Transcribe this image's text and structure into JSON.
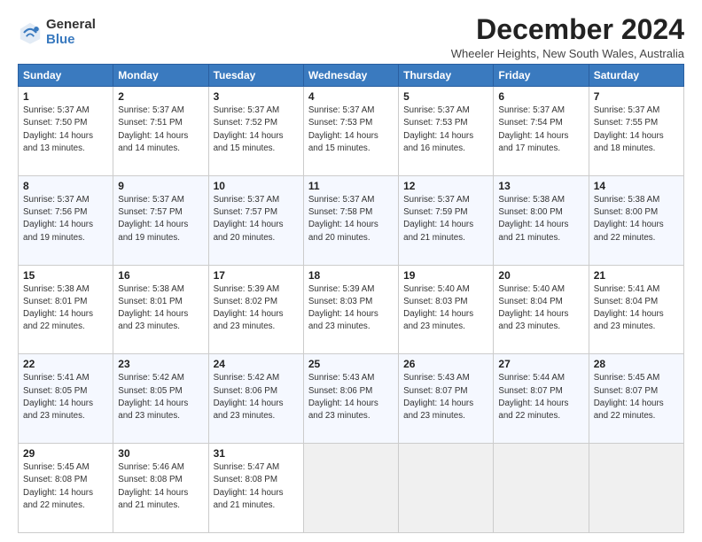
{
  "logo": {
    "general": "General",
    "blue": "Blue"
  },
  "title": "December 2024",
  "location": "Wheeler Heights, New South Wales, Australia",
  "days_of_week": [
    "Sunday",
    "Monday",
    "Tuesday",
    "Wednesday",
    "Thursday",
    "Friday",
    "Saturday"
  ],
  "weeks": [
    [
      {
        "day": "1",
        "info": "Sunrise: 5:37 AM\nSunset: 7:50 PM\nDaylight: 14 hours\nand 13 minutes."
      },
      {
        "day": "2",
        "info": "Sunrise: 5:37 AM\nSunset: 7:51 PM\nDaylight: 14 hours\nand 14 minutes."
      },
      {
        "day": "3",
        "info": "Sunrise: 5:37 AM\nSunset: 7:52 PM\nDaylight: 14 hours\nand 15 minutes."
      },
      {
        "day": "4",
        "info": "Sunrise: 5:37 AM\nSunset: 7:53 PM\nDaylight: 14 hours\nand 15 minutes."
      },
      {
        "day": "5",
        "info": "Sunrise: 5:37 AM\nSunset: 7:53 PM\nDaylight: 14 hours\nand 16 minutes."
      },
      {
        "day": "6",
        "info": "Sunrise: 5:37 AM\nSunset: 7:54 PM\nDaylight: 14 hours\nand 17 minutes."
      },
      {
        "day": "7",
        "info": "Sunrise: 5:37 AM\nSunset: 7:55 PM\nDaylight: 14 hours\nand 18 minutes."
      }
    ],
    [
      {
        "day": "8",
        "info": "Sunrise: 5:37 AM\nSunset: 7:56 PM\nDaylight: 14 hours\nand 19 minutes."
      },
      {
        "day": "9",
        "info": "Sunrise: 5:37 AM\nSunset: 7:57 PM\nDaylight: 14 hours\nand 19 minutes."
      },
      {
        "day": "10",
        "info": "Sunrise: 5:37 AM\nSunset: 7:57 PM\nDaylight: 14 hours\nand 20 minutes."
      },
      {
        "day": "11",
        "info": "Sunrise: 5:37 AM\nSunset: 7:58 PM\nDaylight: 14 hours\nand 20 minutes."
      },
      {
        "day": "12",
        "info": "Sunrise: 5:37 AM\nSunset: 7:59 PM\nDaylight: 14 hours\nand 21 minutes."
      },
      {
        "day": "13",
        "info": "Sunrise: 5:38 AM\nSunset: 8:00 PM\nDaylight: 14 hours\nand 21 minutes."
      },
      {
        "day": "14",
        "info": "Sunrise: 5:38 AM\nSunset: 8:00 PM\nDaylight: 14 hours\nand 22 minutes."
      }
    ],
    [
      {
        "day": "15",
        "info": "Sunrise: 5:38 AM\nSunset: 8:01 PM\nDaylight: 14 hours\nand 22 minutes."
      },
      {
        "day": "16",
        "info": "Sunrise: 5:38 AM\nSunset: 8:01 PM\nDaylight: 14 hours\nand 23 minutes."
      },
      {
        "day": "17",
        "info": "Sunrise: 5:39 AM\nSunset: 8:02 PM\nDaylight: 14 hours\nand 23 minutes."
      },
      {
        "day": "18",
        "info": "Sunrise: 5:39 AM\nSunset: 8:03 PM\nDaylight: 14 hours\nand 23 minutes."
      },
      {
        "day": "19",
        "info": "Sunrise: 5:40 AM\nSunset: 8:03 PM\nDaylight: 14 hours\nand 23 minutes."
      },
      {
        "day": "20",
        "info": "Sunrise: 5:40 AM\nSunset: 8:04 PM\nDaylight: 14 hours\nand 23 minutes."
      },
      {
        "day": "21",
        "info": "Sunrise: 5:41 AM\nSunset: 8:04 PM\nDaylight: 14 hours\nand 23 minutes."
      }
    ],
    [
      {
        "day": "22",
        "info": "Sunrise: 5:41 AM\nSunset: 8:05 PM\nDaylight: 14 hours\nand 23 minutes."
      },
      {
        "day": "23",
        "info": "Sunrise: 5:42 AM\nSunset: 8:05 PM\nDaylight: 14 hours\nand 23 minutes."
      },
      {
        "day": "24",
        "info": "Sunrise: 5:42 AM\nSunset: 8:06 PM\nDaylight: 14 hours\nand 23 minutes."
      },
      {
        "day": "25",
        "info": "Sunrise: 5:43 AM\nSunset: 8:06 PM\nDaylight: 14 hours\nand 23 minutes."
      },
      {
        "day": "26",
        "info": "Sunrise: 5:43 AM\nSunset: 8:07 PM\nDaylight: 14 hours\nand 23 minutes."
      },
      {
        "day": "27",
        "info": "Sunrise: 5:44 AM\nSunset: 8:07 PM\nDaylight: 14 hours\nand 22 minutes."
      },
      {
        "day": "28",
        "info": "Sunrise: 5:45 AM\nSunset: 8:07 PM\nDaylight: 14 hours\nand 22 minutes."
      }
    ],
    [
      {
        "day": "29",
        "info": "Sunrise: 5:45 AM\nSunset: 8:08 PM\nDaylight: 14 hours\nand 22 minutes."
      },
      {
        "day": "30",
        "info": "Sunrise: 5:46 AM\nSunset: 8:08 PM\nDaylight: 14 hours\nand 21 minutes."
      },
      {
        "day": "31",
        "info": "Sunrise: 5:47 AM\nSunset: 8:08 PM\nDaylight: 14 hours\nand 21 minutes."
      },
      {
        "day": "",
        "info": ""
      },
      {
        "day": "",
        "info": ""
      },
      {
        "day": "",
        "info": ""
      },
      {
        "day": "",
        "info": ""
      }
    ]
  ]
}
